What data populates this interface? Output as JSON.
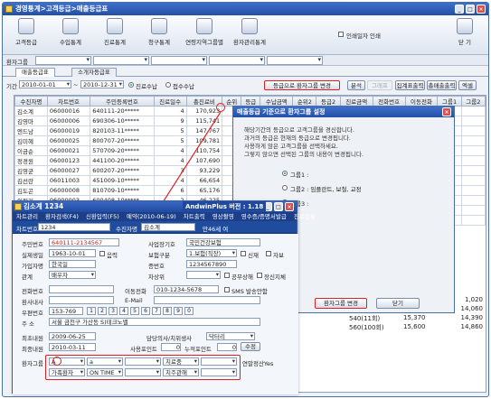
{
  "window": {
    "title": "경영통계>고객등급>매출등급표"
  },
  "toolbar": {
    "buttons": [
      {
        "label": "고객등급"
      },
      {
        "label": "수입통계"
      },
      {
        "label": "진료통계"
      },
      {
        "label": "청구통계"
      },
      {
        "label": "연령지역그룹별"
      },
      {
        "label": "환자관리통계"
      }
    ],
    "print_label": "인쇄일자 인쇄",
    "close_label": "닫 기"
  },
  "filter": {
    "label": "환자그룹"
  },
  "tabs": [
    {
      "label": "매출등급표"
    },
    {
      "label": "소개자등급표"
    }
  ],
  "controls": {
    "period_label": "기간",
    "date_from": "2010-01-01",
    "date_to": "2010-12-31",
    "radio1": "진료수납",
    "radio2": "접수수납",
    "change_button": "등급으로 환자그룹 변경",
    "analysis_button": "분석",
    "graph_button": "그래프",
    "summary_button": "집계표출력",
    "sales_button": "총매출출력",
    "excel_button": "엑셀"
  },
  "grid": {
    "columns": [
      "수진자명",
      "차트번호",
      "주민등록번호",
      "진료일수",
      "총진료비",
      "순위",
      "등급",
      "수납금액",
      "순위2",
      "등급2",
      "진료금액",
      "전화번호",
      "이동전화",
      "그룹1",
      "그룹2"
    ],
    "rows": [
      [
        "김소계",
        "06000016",
        "640111-20*****",
        "4",
        "170,923",
        "1",
        "A"
      ],
      [
        "김영마",
        "06000006",
        "690306-10*****",
        "9",
        "115,741",
        "4",
        "B"
      ],
      [
        "엔드남",
        "06000019",
        "820103-11*****",
        "5",
        "147,767",
        "2",
        "B"
      ],
      [
        "김미혜",
        "06000025",
        "800707-20*****",
        "5",
        "109,781",
        "6",
        "B"
      ],
      [
        "이금순",
        "06000021",
        "570709-20*****",
        "4",
        "110,754",
        "5",
        "B"
      ],
      [
        "정경원",
        "06000123",
        "441100-20*****",
        "4",
        "107,690",
        "7",
        "B"
      ],
      [
        "김영균",
        "06000027",
        "600207-20*****",
        "3",
        "93,229",
        "8",
        "B"
      ],
      [
        "김선란",
        "06011003",
        "451009-10*****",
        "4",
        "66,654",
        "9",
        "B"
      ],
      [
        "김도곤",
        "06000008",
        "810709-10*****",
        "6",
        "65,176",
        "10",
        "C"
      ],
      [
        "이필기",
        "06000003",
        "600408-10*****",
        "2",
        "46,225",
        "11",
        "C"
      ],
      [
        "최정민",
        "06011014",
        "771039-23*****",
        "2",
        "29,928",
        "14",
        "C"
      ],
      [
        "김선민",
        "06000110",
        "",
        "1",
        "21,210",
        "",
        "C"
      ]
    ],
    "right_values": [
      [
        "",
        "1,020"
      ],
      [
        "",
        "14,060"
      ],
      [
        "540(11회)",
        "15,370",
        "14,390"
      ],
      [
        "560(100회)",
        "15,600",
        "14,860"
      ]
    ]
  },
  "dialog": {
    "title": "매출등급 기준으로 환자그룹 설정",
    "line1": "해당기간의 등급으로 고객그룹을 경신합니다.",
    "line2": "과거의 등급은 현재의 등급으로 변경됩니다.",
    "line3": "사용하게 않은 고객그룹을 선택하세요.",
    "line4": "그렇지 않으면 선택된 그룹의 내용이 변경됩니다.",
    "option1": "그룹1 :",
    "option2": "그룹2 : 임플란트, 보철, 교정",
    "option3": "그룹3 :",
    "ok_button": "환자그룹 변경",
    "close_button": "닫기"
  },
  "customer": {
    "title": "김소계 1234",
    "version": "AndwinPlus 버전 : 1.18",
    "menu": [
      "차트관리",
      "환자검색(F4)",
      "신환입력(F5)",
      "예약(2010-06-19)",
      "차트출력",
      "영상촬영",
      "영수증/증명서발급",
      "진료현황"
    ],
    "chart_no_label": "차트번호",
    "chart_no": "1234",
    "patient_label": "수진자명",
    "patient": "김소계",
    "age": "만46세 여",
    "ssn_label": "주민번호",
    "ssn": "640111-2134567",
    "biz_label": "사업장기호",
    "biz": "국민건강보험",
    "birth_label": "실제생일",
    "birth": "1963-10-01",
    "lunar": "음력",
    "insure_label": "보험구분",
    "insure": "1.보험(직장)",
    "self": "신재",
    "sub": "자보",
    "company_label": "가입자명",
    "company": "한국일",
    "cert_label": "증번호",
    "cert": "1234567890",
    "rel_label": "관계",
    "rel": "배우자",
    "tax_label": "차상위",
    "inherit": "공무상해",
    "disabled": "장신지체",
    "phone_label": "전화번호",
    "mobile_label": "이동전화",
    "mobile": "010-1234-5678",
    "sms": "SMS 발송안함",
    "work_label": "환사내사",
    "email_label": "E-Mail",
    "zip_label": "우편번호",
    "zip": "153-769",
    "zipdigits": [
      "1",
      "2",
      "3",
      "4",
      "5",
      "6",
      "7",
      "8",
      "9",
      "0"
    ],
    "addr_label": "주 소",
    "addr": "서울 금천구 가산동 S)테크노밸",
    "first_label": "최초내원",
    "first": "2009-06-25",
    "doctor_label": "담당의사/치위생사",
    "doctor": "닥터리",
    "last_label": "최종내원",
    "last": "2010-03-11",
    "points_label": "사용포인트",
    "points": "0",
    "total_points_label": "누적포인트",
    "total_points": "0",
    "points_btn": "수정",
    "group_label": "환자그룹",
    "group_a": "A",
    "group_b": "a",
    "group_c": "치료중",
    "group_d": "연말정산Yes",
    "group2_a": "가족환자",
    "group2_b": "ON TIME",
    "group2_c": "치주관해"
  }
}
